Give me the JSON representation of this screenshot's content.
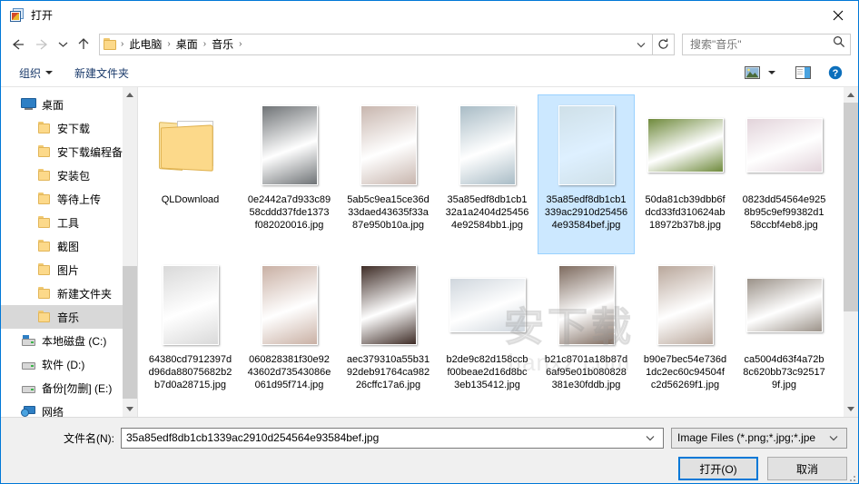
{
  "window": {
    "title": "打开",
    "title_icon": "open-file-icon",
    "close_icon": "close-icon"
  },
  "nav": {
    "back_icon": "arrow-left-icon",
    "forward_icon": "arrow-right-icon",
    "recent_icon": "chevron-down-icon",
    "up_icon": "arrow-up-icon",
    "folder_icon": "folder-icon",
    "breadcrumbs": [
      "此电脑",
      "桌面",
      "音乐"
    ],
    "separator": "›",
    "address_chevron_icon": "chevron-down-icon",
    "refresh_icon": "refresh-icon"
  },
  "search": {
    "placeholder": "搜索\"音乐\"",
    "icon": "search-icon"
  },
  "commandbar": {
    "organize_label": "组织",
    "organize_caret_icon": "caret-down-icon",
    "new_folder_label": "新建文件夹",
    "view_icon": "view-picture-icon",
    "view_caret_icon": "caret-down-icon",
    "preview_pane_icon": "preview-pane-icon",
    "help_icon": "help-icon"
  },
  "sidebar": {
    "items": [
      {
        "label": "桌面",
        "icon": "desktop-icon",
        "depth": 0,
        "selected": false
      },
      {
        "label": "安下载",
        "icon": "folder-icon",
        "depth": 1,
        "selected": false
      },
      {
        "label": "安下载编程备份",
        "icon": "folder-icon",
        "depth": 1,
        "selected": false
      },
      {
        "label": "安装包",
        "icon": "folder-icon",
        "depth": 1,
        "selected": false
      },
      {
        "label": "等待上传",
        "icon": "folder-icon",
        "depth": 1,
        "selected": false
      },
      {
        "label": "工具",
        "icon": "folder-icon",
        "depth": 1,
        "selected": false
      },
      {
        "label": "截图",
        "icon": "folder-icon",
        "depth": 1,
        "selected": false
      },
      {
        "label": "图片",
        "icon": "folder-icon",
        "depth": 1,
        "selected": false
      },
      {
        "label": "新建文件夹",
        "icon": "folder-icon",
        "depth": 1,
        "selected": false
      },
      {
        "label": "音乐",
        "icon": "folder-icon",
        "depth": 1,
        "selected": true
      },
      {
        "label": "本地磁盘 (C:)",
        "icon": "system-drive-icon",
        "depth": 0,
        "selected": false
      },
      {
        "label": "软件 (D:)",
        "icon": "drive-icon",
        "depth": 0,
        "selected": false
      },
      {
        "label": "备份[勿删] (E:)",
        "icon": "drive-icon",
        "depth": 0,
        "selected": false
      },
      {
        "label": "网络",
        "icon": "network-icon",
        "depth": 0,
        "selected": false
      }
    ]
  },
  "files": [
    {
      "name": "QLDownload",
      "type": "folder",
      "selected": false,
      "thumb": "#f2d48a"
    },
    {
      "name": "0e2442a7d933c8958cddd37fde1373f082020016.jpg",
      "type": "image",
      "selected": false,
      "thumb": "#6f7376",
      "orientation": "portrait"
    },
    {
      "name": "5ab5c9ea15ce36d33daed43635f33a87e950b10a.jpg",
      "type": "image",
      "selected": false,
      "thumb": "#c8b6ae",
      "orientation": "portrait"
    },
    {
      "name": "35a85edf8db1cb132a1a2404d254564e92584bb1.jpg",
      "type": "image",
      "selected": false,
      "thumb": "#a9bcc6",
      "orientation": "portrait"
    },
    {
      "name": "35a85edf8db1cb1339ac2910d254564e93584bef.jpg",
      "type": "image",
      "selected": true,
      "thumb": "#cfe0e8",
      "orientation": "portrait"
    },
    {
      "name": "50da81cb39dbb6fdcd33fd310624ab18972b37b8.jpg",
      "type": "image",
      "selected": false,
      "thumb": "#6f8a3c",
      "orientation": "landscape"
    },
    {
      "name": "0823dd54564e9258b95c9ef99382d158ccbf4eb8.jpg",
      "type": "image",
      "selected": false,
      "thumb": "#e2d3da",
      "orientation": "landscape"
    },
    {
      "name": "64380cd7912397dd96da88075682b2b7d0a28715.jpg",
      "type": "image",
      "selected": false,
      "thumb": "#d9d9d9",
      "orientation": "portrait"
    },
    {
      "name": "060828381f30e9243602d73543086e061d95f714.jpg",
      "type": "image",
      "selected": false,
      "thumb": "#c9b0a4",
      "orientation": "portrait"
    },
    {
      "name": "aec379310a55b3192deb91764ca98226cffc17a6.jpg",
      "type": "image",
      "selected": false,
      "thumb": "#3e2c26",
      "orientation": "portrait"
    },
    {
      "name": "b2de9c82d158ccbf00beae2d16d8bc3eb135412.jpg",
      "type": "image",
      "selected": false,
      "thumb": "#cfd6dd",
      "orientation": "landscape"
    },
    {
      "name": "b21c8701a18b87d6af95e01b080828381e30fddb.jpg",
      "type": "image",
      "selected": false,
      "thumb": "#7e6b5f",
      "orientation": "portrait"
    },
    {
      "name": "b90e7bec54e736d1dc2ec60c94504fc2d56269f1.jpg",
      "type": "image",
      "selected": false,
      "thumb": "#b9a79b",
      "orientation": "portrait"
    },
    {
      "name": "ca5004d63f4a72b8c620bb73c925179f.jpg",
      "type": "image",
      "selected": false,
      "thumb": "#9b9289",
      "orientation": "landscape"
    }
  ],
  "watermark": {
    "cn": "安下载",
    "en": "hanxz.com"
  },
  "footer": {
    "filename_label": "文件名(N):",
    "filename_value": "35a85edf8db1cb1339ac2910d254564e93584bef.jpg",
    "filename_chevron_icon": "chevron-down-icon",
    "filter_value": "Image Files (*.png;*.jpg;*.jpe",
    "filter_chevron_icon": "chevron-down-icon",
    "open_label": "打开(O)",
    "cancel_label": "取消",
    "resize_grip_icon": "resize-grip-icon"
  },
  "colors": {
    "accent": "#0078d7",
    "selection": "#cce8ff",
    "selection_border": "#99d1ff",
    "sidebar_selected": "#d8d8d8",
    "footer_bg": "#f0f0f0"
  }
}
